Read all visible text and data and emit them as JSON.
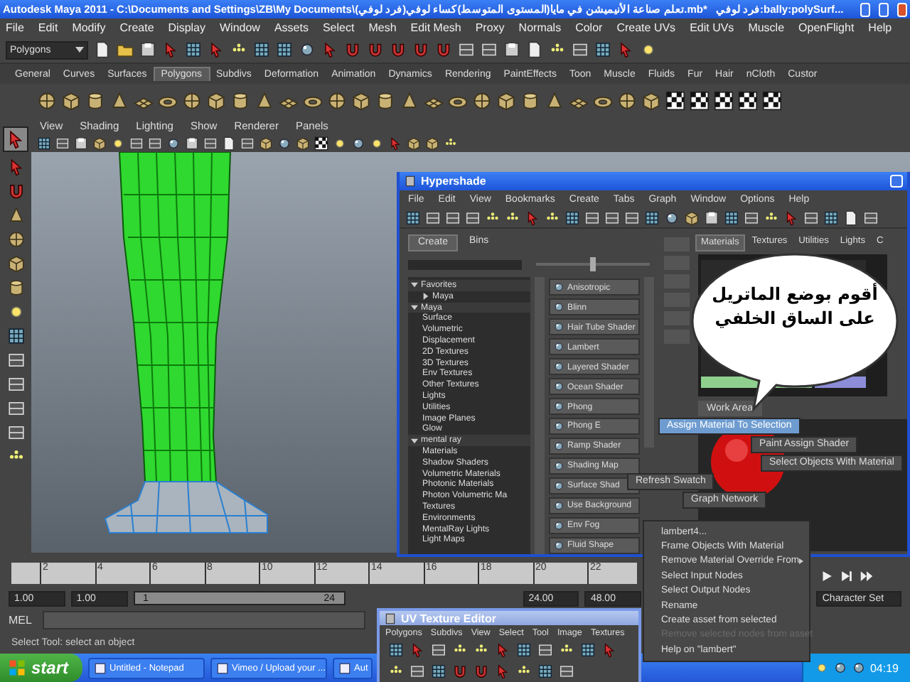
{
  "window": {
    "title": "Autodesk Maya 2011 - C:\\Documents and Settings\\ZB\\My Documents\\تعلم صناعة الأنيميشن في مايا(المستوى المتوسط)كساء لوفي(فرد لوفي).mb*",
    "selection": "فرد لوفي:bally:polySurf..."
  },
  "menu_bar": [
    "File",
    "Edit",
    "Modify",
    "Create",
    "Display",
    "Window",
    "Assets",
    "Select",
    "Mesh",
    "Edit Mesh",
    "Proxy",
    "Normals",
    "Color",
    "Create UVs",
    "Edit UVs",
    "Muscle",
    "OpenFlight",
    "Help"
  ],
  "status_line": {
    "mode": "Polygons"
  },
  "shelf_tabs": [
    {
      "label": "General",
      "selected": false
    },
    {
      "label": "Curves",
      "selected": false
    },
    {
      "label": "Surfaces",
      "selected": false
    },
    {
      "label": "Polygons",
      "selected": true
    },
    {
      "label": "Subdivs",
      "selected": false
    },
    {
      "label": "Deformation",
      "selected": false
    },
    {
      "label": "Animation",
      "selected": false
    },
    {
      "label": "Dynamics",
      "selected": false
    },
    {
      "label": "Rendering",
      "selected": false
    },
    {
      "label": "PaintEffects",
      "selected": false
    },
    {
      "label": "Toon",
      "selected": false
    },
    {
      "label": "Muscle",
      "selected": false
    },
    {
      "label": "Fluids",
      "selected": false
    },
    {
      "label": "Fur",
      "selected": false
    },
    {
      "label": "Hair",
      "selected": false
    },
    {
      "label": "nCloth",
      "selected": false
    },
    {
      "label": "Custor",
      "selected": false
    }
  ],
  "panel_menu": [
    "View",
    "Shading",
    "Lighting",
    "Show",
    "Renderer",
    "Panels"
  ],
  "timeline": {
    "ticks": [
      "2",
      "4",
      "6",
      "8",
      "10",
      "12",
      "14",
      "16",
      "18",
      "20",
      "22"
    ]
  },
  "range_slider": {
    "start": "1.00",
    "current": "1.00",
    "range_start": "1",
    "range_end": "24",
    "end": "24.00",
    "max": "48.00"
  },
  "character_set": "Character Set",
  "command_line": {
    "label": "MEL"
  },
  "help_line": "Select Tool: select an object",
  "hypershade": {
    "title": "Hypershade",
    "menu": [
      "File",
      "Edit",
      "View",
      "Bookmarks",
      "Create",
      "Tabs",
      "Graph",
      "Window",
      "Options",
      "Help"
    ],
    "icon_size": {
      "level": 0.5
    },
    "create_tabs": [
      {
        "label": "Create",
        "selected": true
      },
      {
        "label": "Bins",
        "selected": false
      }
    ],
    "tree": [
      {
        "label": "Favorites",
        "expanded": true,
        "children": [
          {
            "label": "Maya",
            "expanded": false
          }
        ]
      },
      {
        "label": "Maya",
        "expanded": true,
        "children": [
          {
            "label": "Surface"
          },
          {
            "label": "Volumetric"
          },
          {
            "label": "Displacement"
          },
          {
            "label": "2D Textures"
          },
          {
            "label": "3D Textures"
          },
          {
            "label": "Env Textures"
          },
          {
            "label": "Other Textures"
          },
          {
            "label": "Lights"
          },
          {
            "label": "Utilities"
          },
          {
            "label": "Image Planes"
          },
          {
            "label": "Glow"
          }
        ]
      },
      {
        "label": "mental ray",
        "expanded": true,
        "children": [
          {
            "label": "Materials"
          },
          {
            "label": "Shadow Shaders"
          },
          {
            "label": "Volumetric Materials"
          },
          {
            "label": "Photonic Materials"
          },
          {
            "label": "Photon Volumetric Ma"
          },
          {
            "label": "Textures"
          },
          {
            "label": "Environments"
          },
          {
            "label": "MentalRay Lights"
          },
          {
            "label": "Light Maps"
          }
        ]
      }
    ],
    "shaders": [
      "Anisotropic",
      "Blinn",
      "Hair Tube Shader",
      "Lambert",
      "Layered Shader",
      "Ocean Shader",
      "Phong",
      "Phong E",
      "Ramp Shader",
      "Shading Map",
      "Surface Shad",
      "Use Background",
      "Env Fog",
      "Fluid Shape"
    ],
    "tabs": [
      {
        "label": "Materials",
        "selected": true
      },
      {
        "label": "Textures",
        "selected": false
      },
      {
        "label": "Utilities",
        "selected": false
      },
      {
        "label": "Lights",
        "selected": false
      },
      {
        "label": "C",
        "selected": false
      }
    ],
    "work_area_tab": "Work Area"
  },
  "marking_menu": [
    {
      "label": "Assign Material To Selection",
      "selected": true
    },
    {
      "label": "Paint Assign Shader",
      "selected": false
    },
    {
      "label": "Select Objects With Material",
      "selected": false
    },
    {
      "label": "Refresh Swatch",
      "selected": false
    },
    {
      "label": "Graph Network",
      "selected": false
    }
  ],
  "context_menu": [
    {
      "label": "lambert4...",
      "disabled": false,
      "submenu": false
    },
    {
      "label": "Frame Objects With Material",
      "disabled": false,
      "submenu": false
    },
    {
      "label": "Remove Material Override From",
      "disabled": false,
      "submenu": true
    },
    {
      "label": "Select Input Nodes",
      "disabled": false,
      "submenu": false
    },
    {
      "label": "Select Output Nodes",
      "disabled": false,
      "submenu": false
    },
    {
      "label": "Rename",
      "disabled": false,
      "submenu": false
    },
    {
      "label": "Create asset from selected",
      "disabled": false,
      "submenu": false
    },
    {
      "label": "Remove selected nodes from asset",
      "disabled": true,
      "submenu": false
    },
    {
      "label": "Help on \"lambert\"",
      "disabled": false,
      "submenu": false
    }
  ],
  "speech_bubble": {
    "lines": [
      "أقوم بوضع الماتريل",
      "على الساق الخلفي"
    ]
  },
  "uv_editor": {
    "title": "UV Texture Editor",
    "menu": [
      "Polygons",
      "Subdivs",
      "View",
      "Select",
      "Tool",
      "Image",
      "Textures"
    ]
  },
  "taskbar": {
    "start": "start",
    "tasks": [
      "Untitled - Notepad",
      "Vimeo / Upload your ...",
      "Aut"
    ],
    "clock": "04:19"
  }
}
